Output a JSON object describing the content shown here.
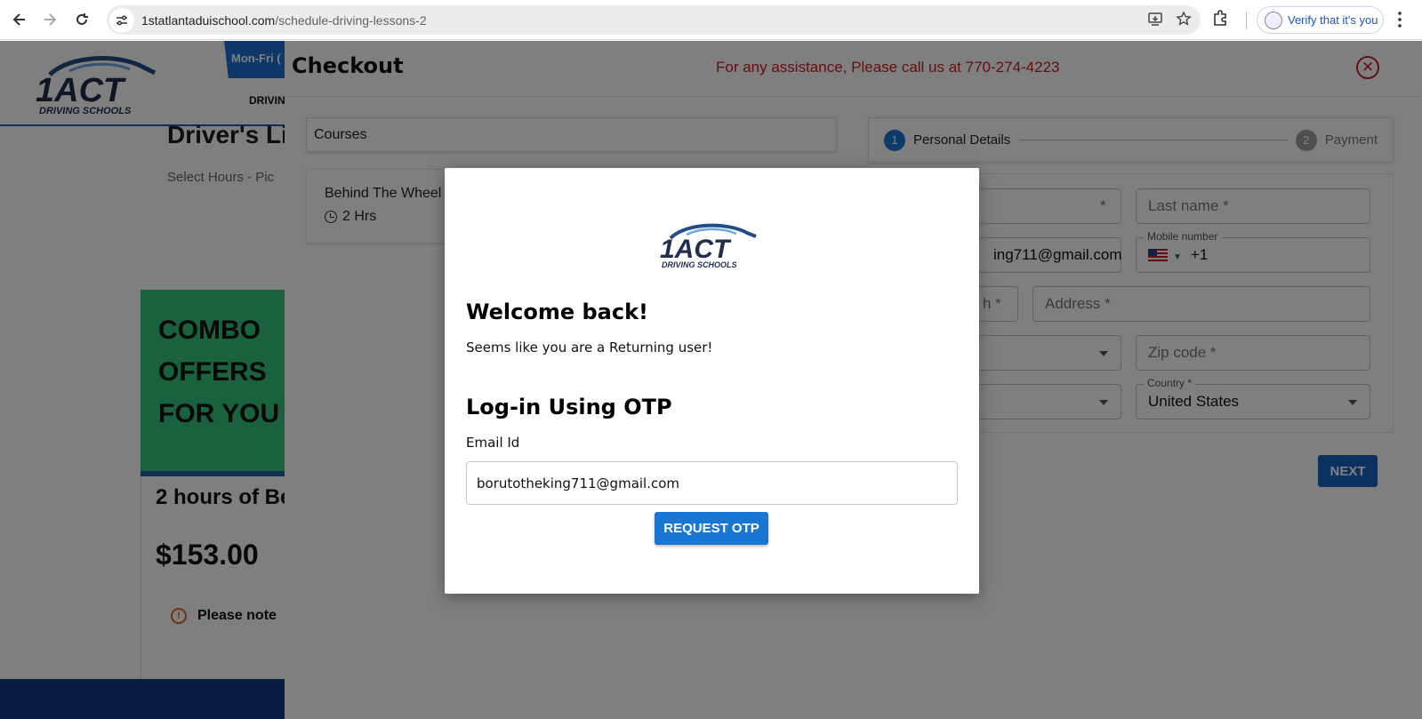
{
  "browser": {
    "url_host": "1statlantaduischool.com",
    "url_path": "/schedule-driving-lessons-2",
    "profile_chip": "Verify that it's you",
    "icons": [
      "back-icon",
      "forward-icon",
      "reload-icon",
      "site-info-icon",
      "install-icon",
      "star-icon",
      "extensions-icon",
      "menu-icon"
    ]
  },
  "site": {
    "logo_text": "1ACT",
    "logo_subtext": "DRIVING SCHOOLS",
    "hours_tab": "Mon-Fri (",
    "nav_item": "DRIVIN",
    "page_title": "Driver's Li",
    "page_subtitle": "Select Hours - Pic",
    "combo_lines": [
      "COMBO",
      "OFFERS",
      "FOR YOU"
    ],
    "package_title": "2 hours of Be",
    "package_price": "$153.00",
    "note": "Please note"
  },
  "checkout": {
    "title": "Checkout",
    "assistance": "For any assistance, Please call us at 770-274-4223",
    "courses_header": "Courses",
    "course_name": "Behind The Wheel",
    "course_duration": "2 Hrs",
    "steps": [
      {
        "num": "1",
        "label": "Personal Details",
        "active": true
      },
      {
        "num": "2",
        "label": "Payment",
        "active": false
      }
    ],
    "fields": {
      "first_name_partial": "*",
      "last_name": "Last name *",
      "email_partial": "ing711@gmail.com",
      "mobile_label": "Mobile number",
      "mobile_value": "+1",
      "dob_partial": "h *",
      "address": "Address *",
      "zip": "Zip code *",
      "country_label": "Country *",
      "country_value": "United States"
    },
    "next_label": "NEXT"
  },
  "modal": {
    "logo_text": "1ACT",
    "logo_subtext": "DRIVING SCHOOLS",
    "welcome": "Welcome back!",
    "returning": "Seems like you are a Returning user!",
    "login_title": "Log-in Using OTP",
    "email_label": "Email Id",
    "email_value": "borutotheking711@gmail.com",
    "request_otp": "REQUEST OTP"
  },
  "colors": {
    "brand_blue": "#1976d2",
    "assist_red": "#c8201f",
    "combo_green": "#34c47c"
  }
}
